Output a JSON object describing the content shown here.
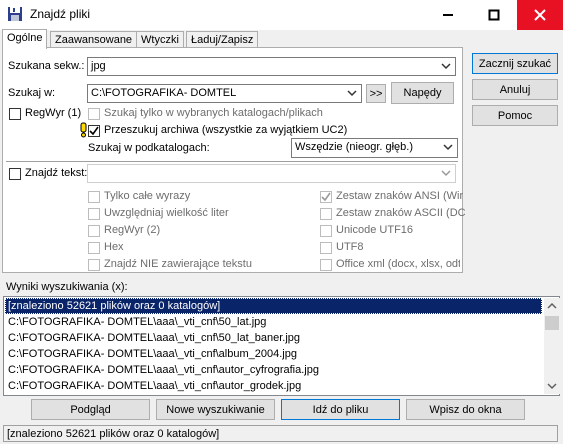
{
  "window": {
    "title": "Znajdź pliki"
  },
  "tabs": [
    "Ogólne",
    "Zaawansowane",
    "Wtyczki",
    "Ładuj/Zapisz"
  ],
  "search": {
    "pattern_label": "Szukana sekw.:",
    "pattern_value": "jpg",
    "in_label": "Szukaj w:",
    "in_value": "C:\\FOTOGRAFIKA- DOMTEL",
    "browse_label": ">>",
    "drives_label": "Napędy",
    "regex_label": "RegWyr (1)",
    "only_selected_label": "Szukaj tylko w wybranych katalogach/plikach",
    "archives_label": "Przeszukuj archiwa (wszystkie za wyjątkiem UC2)",
    "subdirs_label": "Szukaj w podkatalogach:",
    "subdirs_value": "Wszędzie (nieogr. głęb.)",
    "find_text_label": "Znajdź tekst:",
    "find_text_value": ""
  },
  "text_options_left": [
    "Tylko całe wyrazy",
    "Uwzględniaj wielkość liter",
    "RegWyr (2)",
    "Hex",
    "Znajdź NIE zawierające tekstu"
  ],
  "text_options_right": [
    "Zestaw znaków ANSI (Wir",
    "Zestaw znaków ASCII (DC",
    "Unicode UTF16",
    "UTF8",
    "Office xml (docx, xlsx, odt i"
  ],
  "buttons": {
    "start": "Zacznij szukać",
    "cancel": "Anuluj",
    "help": "Pomoc",
    "view": "Podgląd",
    "new_search": "Nowe wyszukiwanie",
    "goto_file": "Idź do pliku",
    "feed": "Wpisz do okna"
  },
  "results": {
    "label": "Wyniki wyszukiwania (x):",
    "rows": [
      "[znaleziono 52621 plików oraz 0 katalogów]",
      "C:\\FOTOGRAFIKA- DOMTEL\\aaa\\_vti_cnf\\50_lat.jpg",
      "C:\\FOTOGRAFIKA- DOMTEL\\aaa\\_vti_cnf\\50_lat_baner.jpg",
      "C:\\FOTOGRAFIKA- DOMTEL\\aaa\\_vti_cnf\\album_2004.jpg",
      "C:\\FOTOGRAFIKA- DOMTEL\\aaa\\_vti_cnf\\autor_cyfrografia.jpg",
      "C:\\FOTOGRAFIKA- DOMTEL\\aaa\\_vti_cnf\\autor_grodek.jpg"
    ]
  },
  "status": "[znaleziono 52621 plików oraz 0 katalogów]"
}
